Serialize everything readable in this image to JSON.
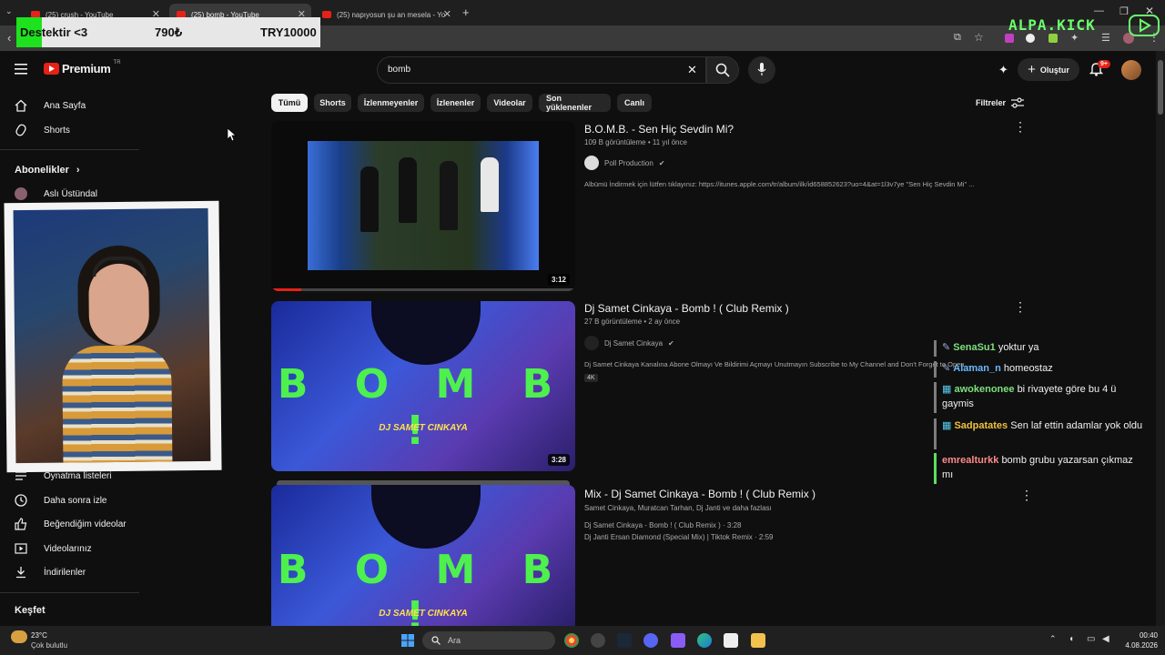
{
  "browser": {
    "tabs": [
      {
        "title": "(25) crush - YouTube"
      },
      {
        "title": "(25) bomb - YouTube"
      },
      {
        "title": "(25) napıyosun şu an mesela - Yo"
      }
    ],
    "new_tab_label": "+"
  },
  "donation": {
    "text": "Destektir <3",
    "amount": "790₺",
    "goal": "TRY10000"
  },
  "overlay_brand": "ALPA.KICK",
  "header": {
    "logo_text": "Premium",
    "logo_region": "TR",
    "search_value": "bomb",
    "create_label": "Oluştur",
    "notifications_badge": "9+"
  },
  "sidebar": {
    "home": "Ana Sayfa",
    "shorts": "Shorts",
    "subscriptions_heading": "Abonelikler",
    "subscription_first": "Aslı Üstündal",
    "items": [
      "Oynatma listeleri",
      "Daha sonra izle",
      "Beğendiğim videolar",
      "Videolarınız",
      "İndirilenler"
    ],
    "explore": "Keşfet"
  },
  "chips": [
    "Tümü",
    "Shorts",
    "İzlenmeyenler",
    "İzlenenler",
    "Videolar",
    "Son yüklenenler",
    "Canlı"
  ],
  "filters_label": "Filtreler",
  "results": [
    {
      "title": "B.O.M.B. - Sen Hiç Sevdin Mi?",
      "meta": "109 B görüntüleme • 11 yıl önce",
      "channel": "Poll Production",
      "description": "Albümü İndirmek için lütfen tıklayınız: https://itunes.apple.com/tr/album/ilk/id658852623?uo=4&at=1l3v7ye \"Sen Hiç Sevdin Mi\" ...",
      "duration": "3:12"
    },
    {
      "title": "Dj Samet Cinkaya - Bomb ! ( Club Remix )",
      "meta": "27 B görüntüleme • 2 ay önce",
      "channel": "Dj Samet Cinkaya",
      "description": "Dj Samet Cinkaya Kanalına Abone Olmayı Ve Bildirimi Açmayı Unutmayın Subscribe to My Channel and Don't Forget to Open ...",
      "badge": "4K",
      "duration": "3:28",
      "thumb_word": "B O M B  !",
      "thumb_sub": "DJ SAMET CINKAYA"
    },
    {
      "title": "Mix - Dj Samet Cinkaya - Bomb ! ( Club Remix )",
      "meta": "Samet Cinkaya, Muratcan Tarhan, Dj Janti ve daha fazlası",
      "track1": "Dj Samet Cinkaya - Bomb ! ( Club Remix ) · 3:28",
      "track2": "Dj Janti Ersan Diamond (Special Mix) | Tiktok Remix · 2:59",
      "thumb_word": "B O M B  !",
      "thumb_sub": "DJ SAMET CINKAYA"
    }
  ],
  "chat": [
    {
      "user": "SenaSu1",
      "message": "yoktur ya",
      "color": "#7de07d"
    },
    {
      "user": "Alaman_n",
      "message": "homeostaz",
      "color": "#6ab8ff"
    },
    {
      "user": "awokenonee",
      "message": "bi rivayete göre bu 4 ü gaymis",
      "color": "#7de07d"
    },
    {
      "user": "Sadpatates",
      "message": "Sen laf ettin adamlar yok oldu",
      "color": "#f0c040"
    },
    {
      "user": "emrealturkk",
      "message": "bomb grubu yazarsan çıkmaz mı",
      "color": "#ff8a8a"
    }
  ],
  "taskbar": {
    "weather_temp": "23°C",
    "weather_desc": "Çok bulutlu",
    "search_label": "Ara",
    "time": "00:40",
    "date": "4.08.2026"
  },
  "colors": {
    "accent_red": "#e62117",
    "chip_active": "#f1f1f1",
    "background": "#0f0f0f"
  }
}
